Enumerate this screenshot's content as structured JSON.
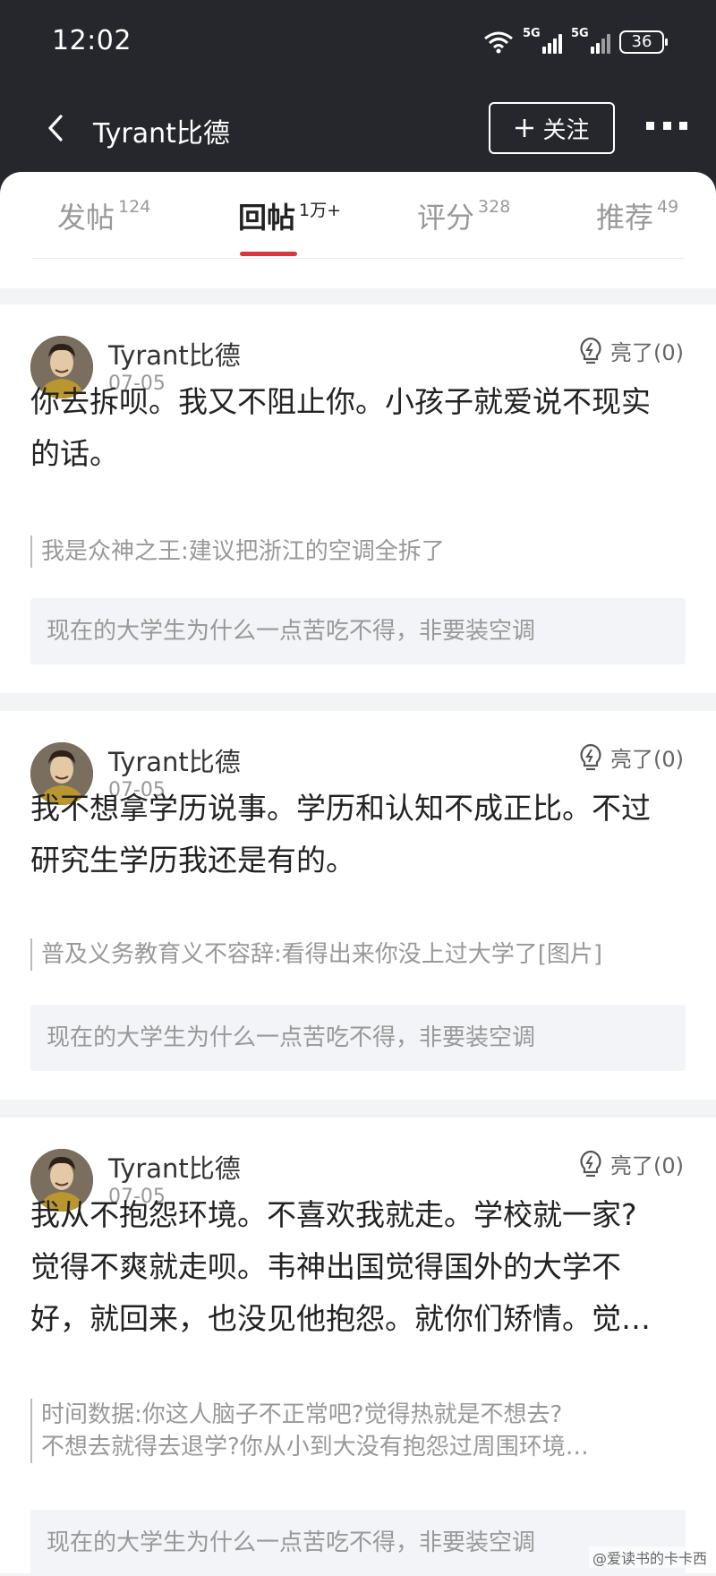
{
  "status": {
    "time": "12:02",
    "network": [
      "5G",
      "5G"
    ],
    "battery": "36"
  },
  "nav": {
    "title": "Tyrant比德",
    "follow_label": "关注",
    "back_icon": "chevron-left-icon",
    "more_icon": "more-dots-icon"
  },
  "tabs": [
    {
      "label": "发帖",
      "count": "124",
      "active": false
    },
    {
      "label": "回帖",
      "count": "1万+",
      "active": true
    },
    {
      "label": "评分",
      "count": "328",
      "active": false
    },
    {
      "label": "推荐",
      "count": "49",
      "active": false
    }
  ],
  "posts": [
    {
      "author": "Tyrant比德",
      "date": "07-05",
      "light": "亮了(0)",
      "content_lines": [
        "你去拆呗。我又不阻止你。小孩子就爱说不现实",
        "的话。"
      ],
      "quote_lines": [
        "我是众神之王:建议把浙江的空调全拆了"
      ],
      "topic": "现在的大学生为什么一点苦吃不得，非要装空调"
    },
    {
      "author": "Tyrant比德",
      "date": "07-05",
      "light": "亮了(0)",
      "content_lines": [
        "我不想拿学历说事。学历和认知不成正比。不过",
        "研究生学历我还是有的。"
      ],
      "quote_lines": [
        "普及义务教育义不容辞:看得出来你没上过大学了[图片]"
      ],
      "topic": "现在的大学生为什么一点苦吃不得，非要装空调"
    },
    {
      "author": "Tyrant比德",
      "date": "07-05",
      "light": "亮了(0)",
      "content_lines": [
        "我从不抱怨环境。不喜欢我就走。学校就一家?",
        "觉得不爽就走呗。韦神出国觉得国外的大学不",
        "好，就回来，也没见他抱怨。就你们矫情。觉…"
      ],
      "quote_lines": [
        "时间数据:你这人脑子不正常吧?觉得热就是不想去?",
        "不想去就得去退学?你从小到大没有抱怨过周围环境…"
      ],
      "topic": "现在的大学生为什么一点苦吃不得，非要装空调"
    }
  ],
  "watermark": "@爱读书的卡卡西",
  "colors": {
    "header": "#25272c",
    "accent": "#d9363e"
  }
}
